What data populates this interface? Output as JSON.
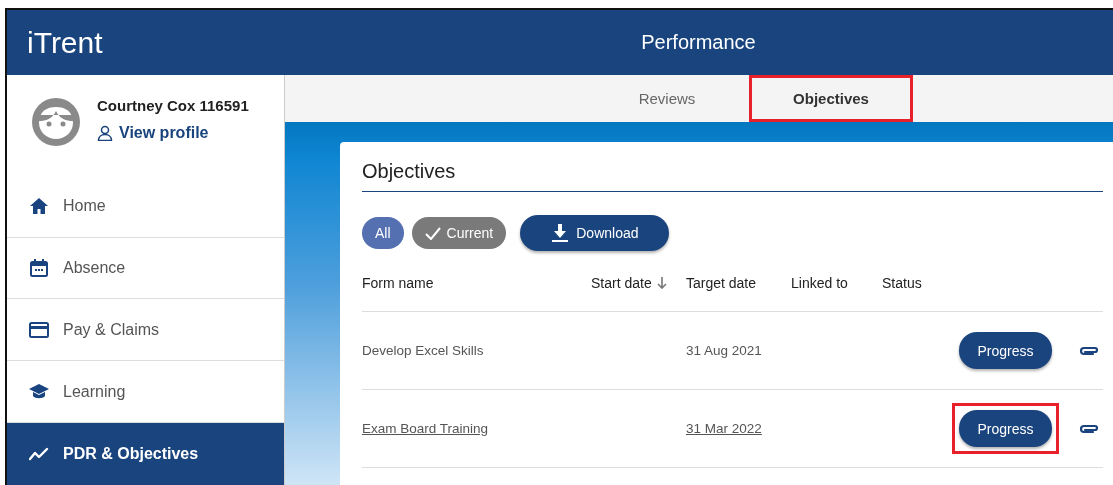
{
  "app": {
    "logo": "iTrent",
    "title": "Performance"
  },
  "user": {
    "name": "Courtney Cox 116591",
    "profile_link": "View profile"
  },
  "nav": [
    {
      "label": "Home",
      "selected": false
    },
    {
      "label": "Absence",
      "selected": false
    },
    {
      "label": "Pay & Claims",
      "selected": false
    },
    {
      "label": "Learning",
      "selected": false
    },
    {
      "label": "PDR & Objectives",
      "selected": true
    }
  ],
  "tabs": [
    {
      "label": "Reviews",
      "selected": false,
      "highlighted": false
    },
    {
      "label": "Objectives",
      "selected": true,
      "highlighted": true
    }
  ],
  "card": {
    "title": "Objectives",
    "filters": [
      {
        "label": "All",
        "selected": true,
        "checked": false
      },
      {
        "label": "Current",
        "selected": false,
        "checked": true
      }
    ],
    "download": "Download",
    "columns": [
      {
        "label": "Form name",
        "sorted": false
      },
      {
        "label": "Start date",
        "sorted": true
      },
      {
        "label": "Target date",
        "sorted": false
      },
      {
        "label": "Linked to",
        "sorted": false
      },
      {
        "label": "Status",
        "sorted": false
      }
    ],
    "rows": [
      {
        "form_name": "Develop Excel Skills",
        "target_date": "31 Aug 2021",
        "link": false,
        "action": "Progress",
        "highlighted": false
      },
      {
        "form_name": "Exam Board Training",
        "target_date": "31 Mar 2022",
        "link": true,
        "action": "Progress",
        "highlighted": true
      }
    ]
  }
}
